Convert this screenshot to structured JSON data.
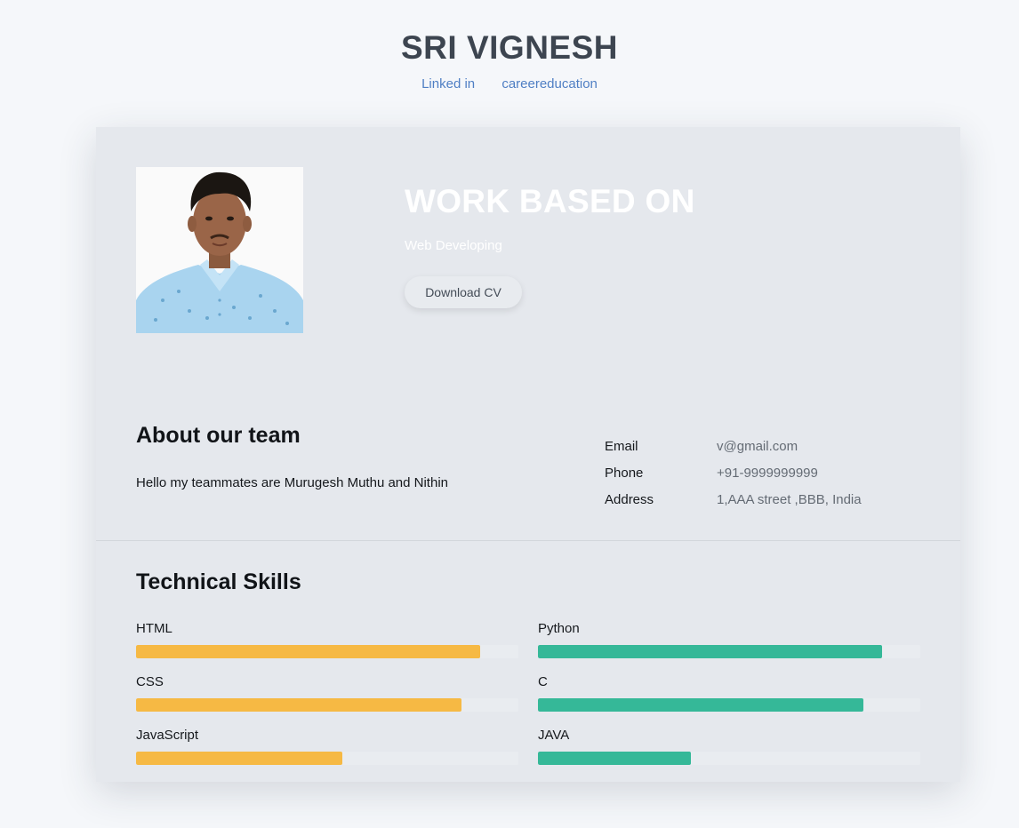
{
  "header": {
    "title": "SRI VIGNESH",
    "links": [
      {
        "label": "Linked in"
      },
      {
        "label": "careereducation"
      }
    ]
  },
  "hero": {
    "title": "WORK BASED ON",
    "subtitle": "Web Developing",
    "button_label": "Download CV"
  },
  "about": {
    "heading": "About our team",
    "text": "Hello my teammates are Murugesh Muthu and Nithin"
  },
  "contact": [
    {
      "label": "Email",
      "value": "v@gmail.com"
    },
    {
      "label": "Phone",
      "value": "+91-9999999999"
    },
    {
      "label": "Address",
      "value": "1,AAA street ,BBB, India"
    }
  ],
  "skills": {
    "heading": "Technical Skills",
    "colors": {
      "left": "#f6b944",
      "right": "#35b898"
    },
    "left": [
      {
        "name": "HTML",
        "level": 90
      },
      {
        "name": "CSS",
        "level": 85
      },
      {
        "name": "JavaScript",
        "level": 54
      }
    ],
    "right": [
      {
        "name": "Python",
        "level": 90
      },
      {
        "name": "C",
        "level": 85
      },
      {
        "name": "JAVA",
        "level": 40
      }
    ]
  }
}
